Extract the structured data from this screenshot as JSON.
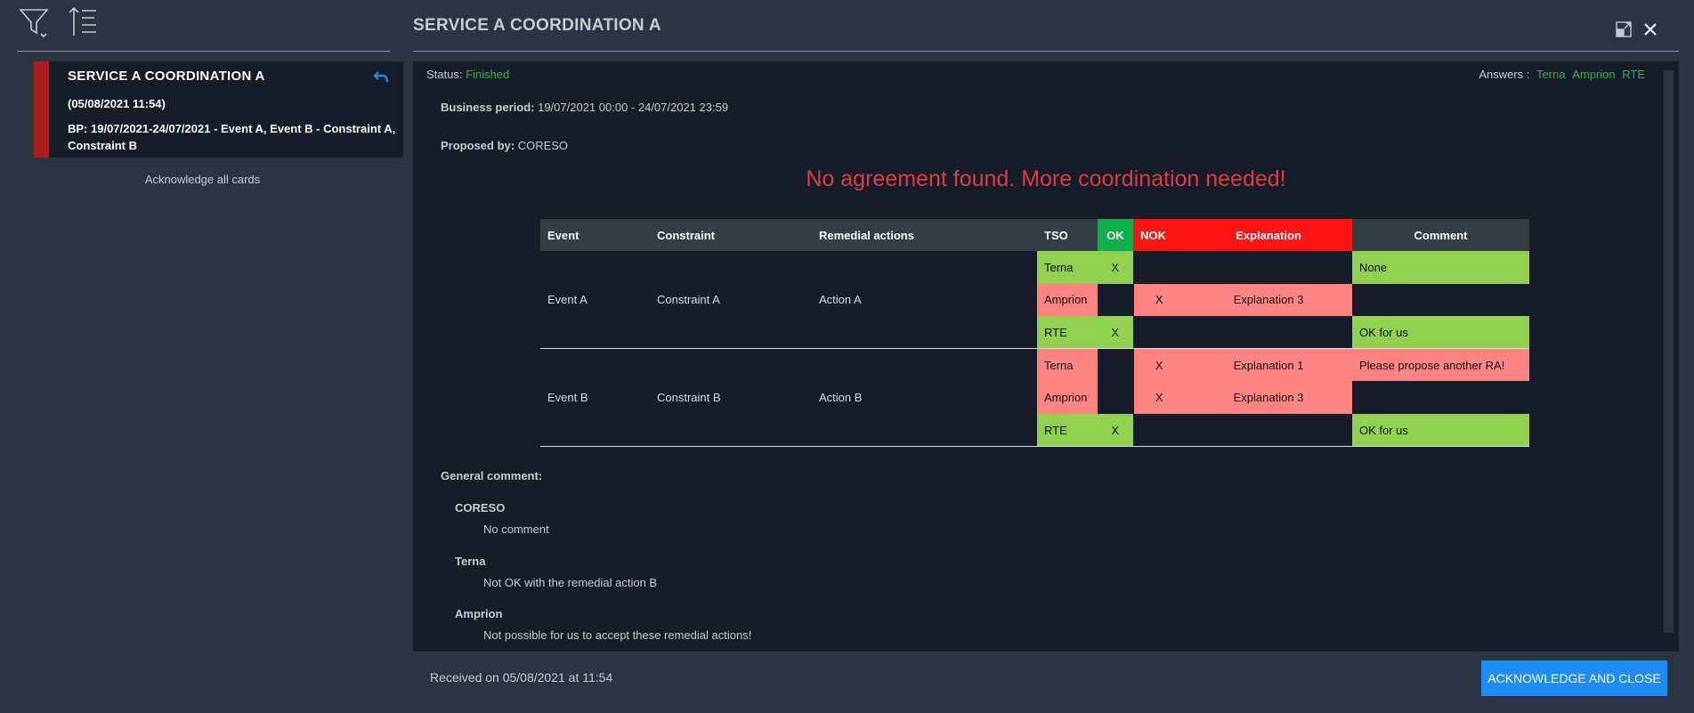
{
  "feed": {
    "filter_icon": "filter-icon",
    "sort_icon": "sort-icon",
    "card": {
      "title": "SERVICE A COORDINATION A",
      "date": "(05/08/2021 11:54)",
      "summary": "BP: 19/07/2021-24/07/2021 - Event A, Event B - Constraint A, Constraint B",
      "severity_color": "#a81d1d",
      "reply_icon": "reply-icon"
    },
    "acknowledge_all": "Acknowledge all cards"
  },
  "detail": {
    "title": "SERVICE A COORDINATION A",
    "expand_icon": "expand-icon",
    "close_icon": "close-icon",
    "status_label": "Status:",
    "status_value": "Finished",
    "answers_label": "Answers :",
    "answers": [
      "Terna",
      "Amprion",
      "RTE"
    ],
    "business_period_label": "Business period:",
    "business_period_value": "19/07/2021 00:00 - 24/07/2021 23:59",
    "proposed_by_label": "Proposed by:",
    "proposed_by_value": "CORESO",
    "alert": "No agreement found. More coordination needed!",
    "table": {
      "headers": {
        "event": "Event",
        "constraint": "Constraint",
        "remedial": "Remedial actions",
        "tso": "TSO",
        "ok": "OK",
        "nok": "NOK",
        "explanation": "Explanation",
        "comment": "Comment"
      },
      "groups": [
        {
          "event": "Event A",
          "constraint": "Constraint A",
          "action": "Action A",
          "rows": [
            {
              "tso": "Terna",
              "ok": "X",
              "nok": "",
              "explanation": "",
              "comment": "None"
            },
            {
              "tso": "Amprion",
              "ok": "",
              "nok": "X",
              "explanation": "Explanation 3",
              "comment": ""
            },
            {
              "tso": "RTE",
              "ok": "X",
              "nok": "",
              "explanation": "",
              "comment": "OK for us"
            }
          ]
        },
        {
          "event": "Event B",
          "constraint": "Constraint B",
          "action": "Action B",
          "rows": [
            {
              "tso": "Terna",
              "ok": "",
              "nok": "X",
              "explanation": "Explanation 1",
              "comment": "Please propose another RA!"
            },
            {
              "tso": "Amprion",
              "ok": "",
              "nok": "X",
              "explanation": "Explanation 3",
              "comment": ""
            },
            {
              "tso": "RTE",
              "ok": "X",
              "nok": "",
              "explanation": "",
              "comment": "OK for us"
            }
          ]
        }
      ]
    },
    "general_comment_label": "General comment:",
    "comments": [
      {
        "author": "CORESO",
        "text": "No comment"
      },
      {
        "author": "Terna",
        "text": "Not OK with the remedial action B"
      },
      {
        "author": "Amprion",
        "text": "Not possible for us to accept these remedial actions!"
      }
    ],
    "received": "Received on 05/08/2021 at 11:54",
    "acknowledge_button": "ACKNOWLEDGE AND CLOSE"
  },
  "colors": {
    "ok_green": "#92d050",
    "nok_red": "#ff8585",
    "alert": "#df3a46",
    "status_green": "#35b24a",
    "button_blue": "#1f8bf5"
  }
}
